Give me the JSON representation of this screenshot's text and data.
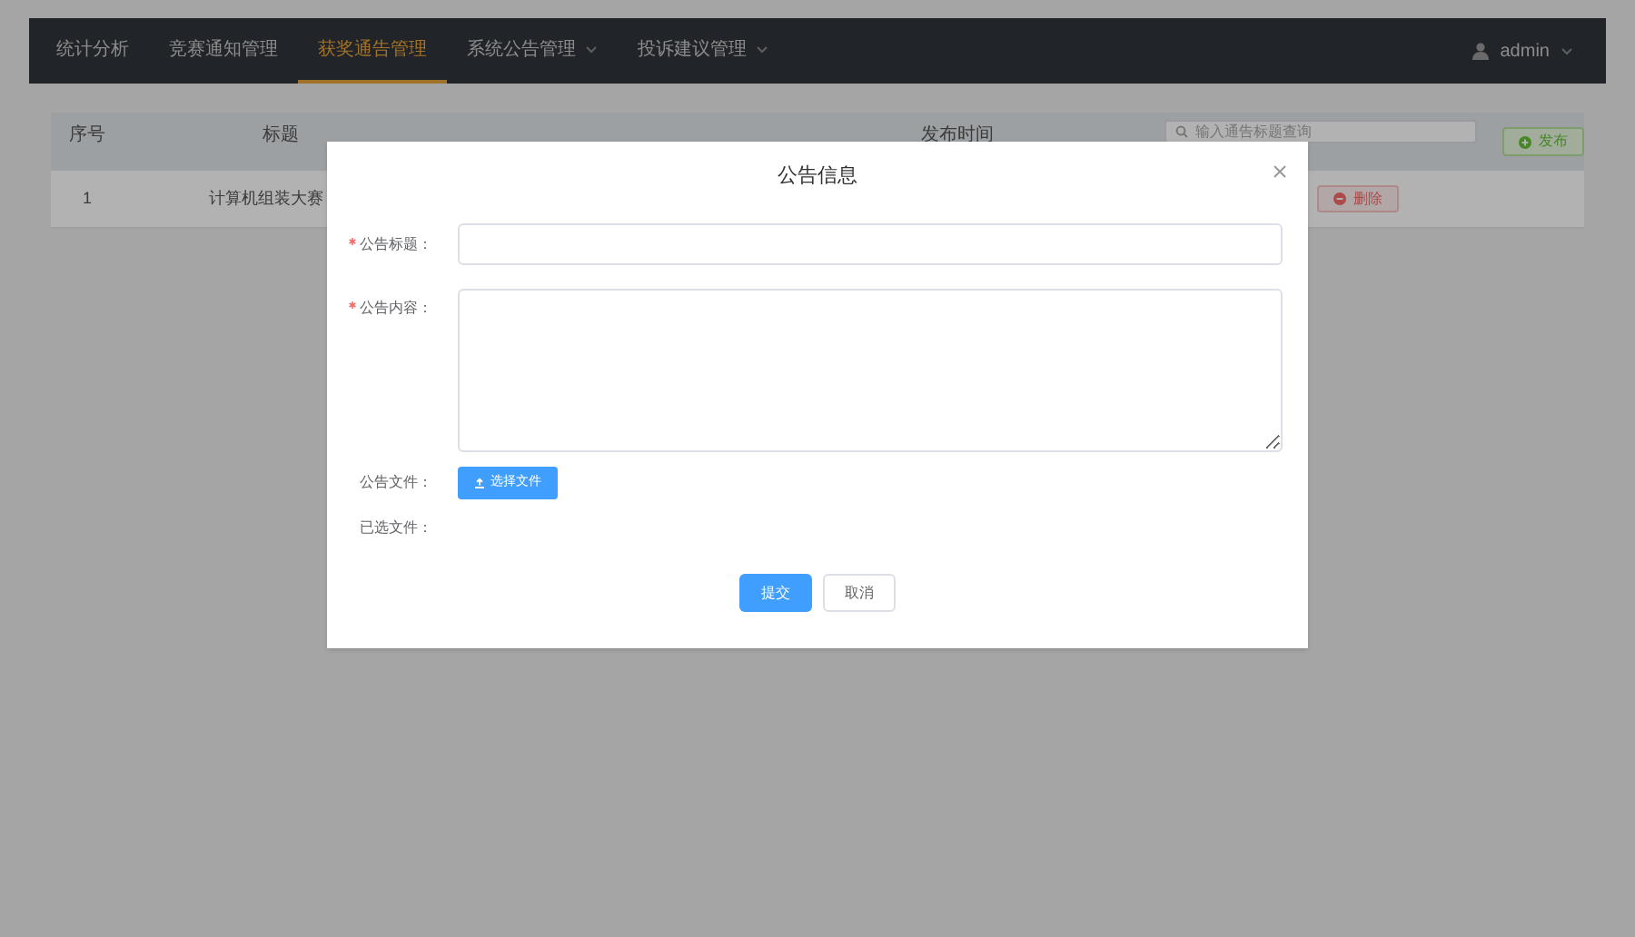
{
  "nav": {
    "items": [
      {
        "label": "统计分析",
        "selected": false,
        "dropdown": false
      },
      {
        "label": "竞赛通知管理",
        "selected": false,
        "dropdown": false
      },
      {
        "label": "获奖通告管理",
        "selected": true,
        "dropdown": false
      },
      {
        "label": "系统公告管理",
        "selected": false,
        "dropdown": true
      },
      {
        "label": "投诉建议管理",
        "selected": false,
        "dropdown": true
      }
    ],
    "user": "admin"
  },
  "table": {
    "columns": [
      "序号",
      "标题",
      "",
      "发布时间"
    ],
    "search": {
      "placeholder": "输入通告标题查询"
    },
    "publish_button": "发布",
    "rows": [
      {
        "index": "1",
        "title": "计算机组装大赛",
        "delete_button": "删除"
      }
    ]
  },
  "dialog": {
    "title": "公告信息",
    "fields": [
      {
        "kind": "input",
        "label": "公告标题：",
        "required": true
      },
      {
        "kind": "textarea",
        "label": "公告内容：",
        "required": true
      },
      {
        "kind": "upload",
        "label": "公告文件：",
        "required": false,
        "button": "选择文件"
      },
      {
        "kind": "text",
        "label": "已选文件：",
        "required": false
      }
    ],
    "buttons": [
      {
        "label": "提交",
        "primary": true
      },
      {
        "label": "取消",
        "primary": false
      }
    ]
  }
}
